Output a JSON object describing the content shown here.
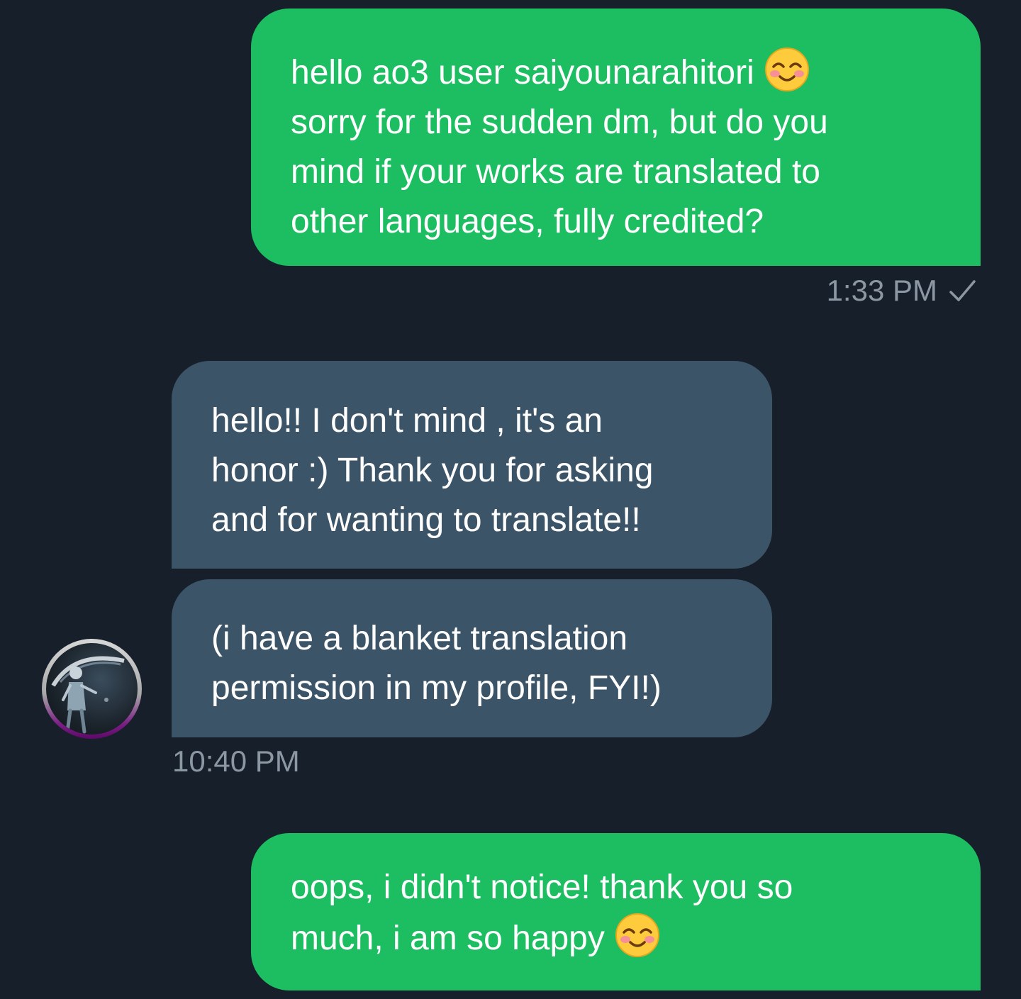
{
  "colors": {
    "background": "#17202a",
    "outgoing_bubble": "#1dbd62",
    "incoming_bubble": "#3c5468",
    "meta_text": "#8b97a3"
  },
  "messages": [
    {
      "direction": "outgoing",
      "lines": [
        "hello ao3 user saiyounarahitori",
        "sorry for the sudden dm, but do you",
        "mind if your works are translated to",
        "other languages, fully credited?"
      ],
      "emoji": "smiling-face-with-smiling-eyes-icon",
      "time": "1:33 PM",
      "status_icon": "check-icon"
    },
    {
      "direction": "incoming",
      "lines": [
        "hello!! I don't mind , it's an",
        "honor :) Thank you for asking",
        "and for wanting to translate!!"
      ]
    },
    {
      "direction": "incoming",
      "lines": [
        "(i have a blanket translation",
        "permission in my profile, FYI!)"
      ],
      "time": "10:40 PM"
    },
    {
      "direction": "outgoing",
      "lines": [
        "oops, i didn't notice! thank you so",
        "much, i am so happy"
      ],
      "emoji": "smiling-face-with-smiling-eyes-icon"
    }
  ]
}
